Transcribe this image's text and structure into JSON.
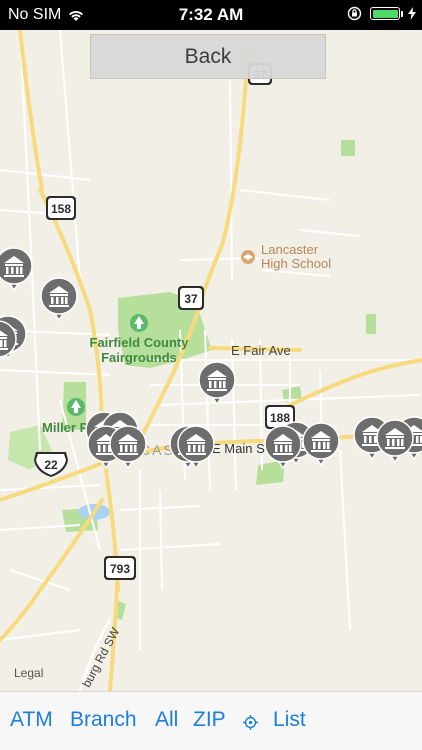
{
  "status_bar": {
    "carrier": "No SIM",
    "time": "7:32 AM",
    "battery_level": 1.0,
    "battery_color": "#4cd964"
  },
  "top_button": {
    "label": "Back"
  },
  "map": {
    "road_shields": [
      "37",
      "158",
      "37",
      "188",
      "22",
      "793"
    ],
    "labels": {
      "lancaster_hs_1": "Lancaster",
      "lancaster_hs_2": "High School",
      "fairgrounds_1": "Fairfield County",
      "fairgrounds_2": "Fairgrounds",
      "fair_ave": "E Fair Ave",
      "miller": "Miller P",
      "main_st": "E Main S",
      "caster": "CASTE",
      "burg_rd": "burg Rd SW",
      "legal": "Legal"
    },
    "pin_icon": "bank-icon",
    "park_icon": "tree-icon",
    "school_icon": "school-icon",
    "colors": {
      "land": "#f2efe6",
      "major_road": "#f6da7d",
      "minor_road": "#ffffff",
      "park": "#b7df9c",
      "water": "#a9d3f0",
      "pin": "#6d6d6d"
    }
  },
  "toolbar": {
    "atm": "ATM",
    "branch": "Branch",
    "all": "All",
    "zip": "ZIP",
    "location_icon": "location-icon",
    "list": "List",
    "accent": "#1a7fe0"
  }
}
